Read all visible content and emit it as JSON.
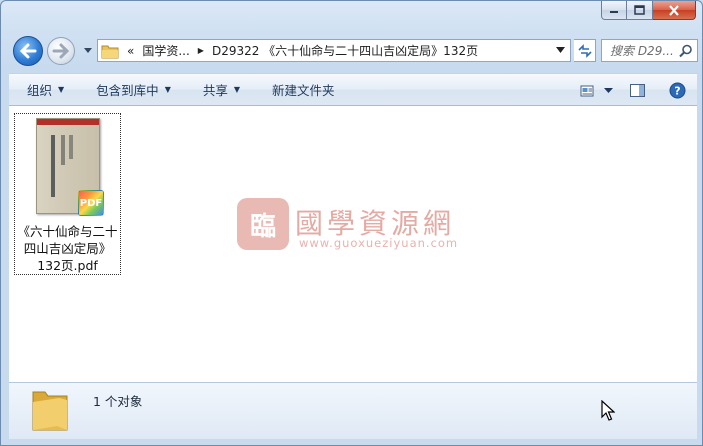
{
  "window": {
    "caption_min": "–",
    "caption_max": "□",
    "caption_close": "✕"
  },
  "address": {
    "overflow": "«",
    "segments": [
      "国学资...",
      "D29322 《六十仙命与二十四山吉凶定局》132页"
    ]
  },
  "search": {
    "placeholder": "搜索 D29..."
  },
  "toolbar": {
    "organize": "组织",
    "include_library": "包含到库中",
    "share": "共享",
    "new_folder": "新建文件夹"
  },
  "files": [
    {
      "name_line1": "《六十仙命与二十",
      "name_line2": "四山吉凶定局》",
      "name_line3": "132页.pdf",
      "badge": "PDF"
    }
  ],
  "watermark": {
    "logo_char": "臨",
    "title": "國學資源網",
    "url": "www.guoxueziyuan.com"
  },
  "status": {
    "count_text": "1 个对象"
  },
  "colors": {
    "accent": "#2f7dd6",
    "watermark": "#e4aaa3"
  }
}
